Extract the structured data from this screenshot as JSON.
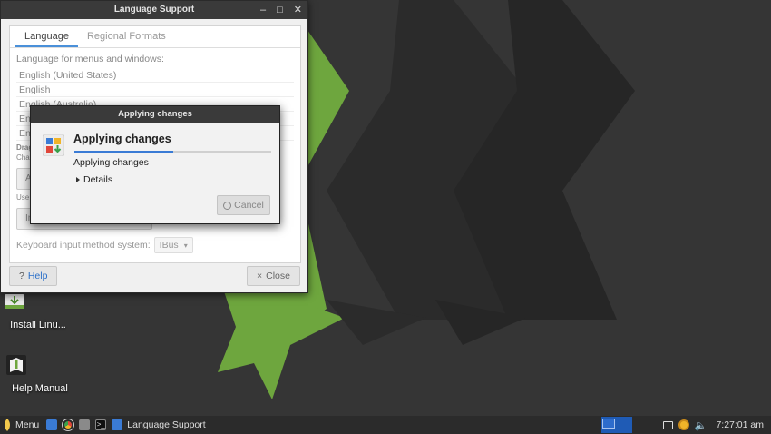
{
  "desktop": {
    "icons": [
      {
        "label": "Install Linu...",
        "icon": "install-icon"
      },
      {
        "label": "Help Manual",
        "icon": "book-icon"
      }
    ],
    "colors": {
      "accent": "#79b44b",
      "background": "#353535"
    }
  },
  "lang_window": {
    "title": "Language Support",
    "tabs": [
      "Language",
      "Regional Formats"
    ],
    "active_tab": "Language",
    "section_label": "Language for menus and windows:",
    "languages": [
      "English (United States)",
      "English",
      "English (Australia)",
      "Eng",
      "Eng"
    ],
    "drag_hint": [
      "Drag",
      "Cha"
    ],
    "partial_labels": {
      "btn1": "A",
      "use": "Use",
      "btn2": "In"
    },
    "keyboard_label": "Keyboard input method system:",
    "keyboard_value": "IBus",
    "help_label": "Help",
    "close_label": "Close"
  },
  "dialog": {
    "title": "Applying changes",
    "heading": "Applying changes",
    "progress": 0.5,
    "status": "Applying changes",
    "details_label": "Details",
    "cancel_label": "Cancel"
  },
  "taskbar": {
    "menu_label": "Menu",
    "task_label": "Language Support",
    "clock": "7:27:01 am"
  }
}
